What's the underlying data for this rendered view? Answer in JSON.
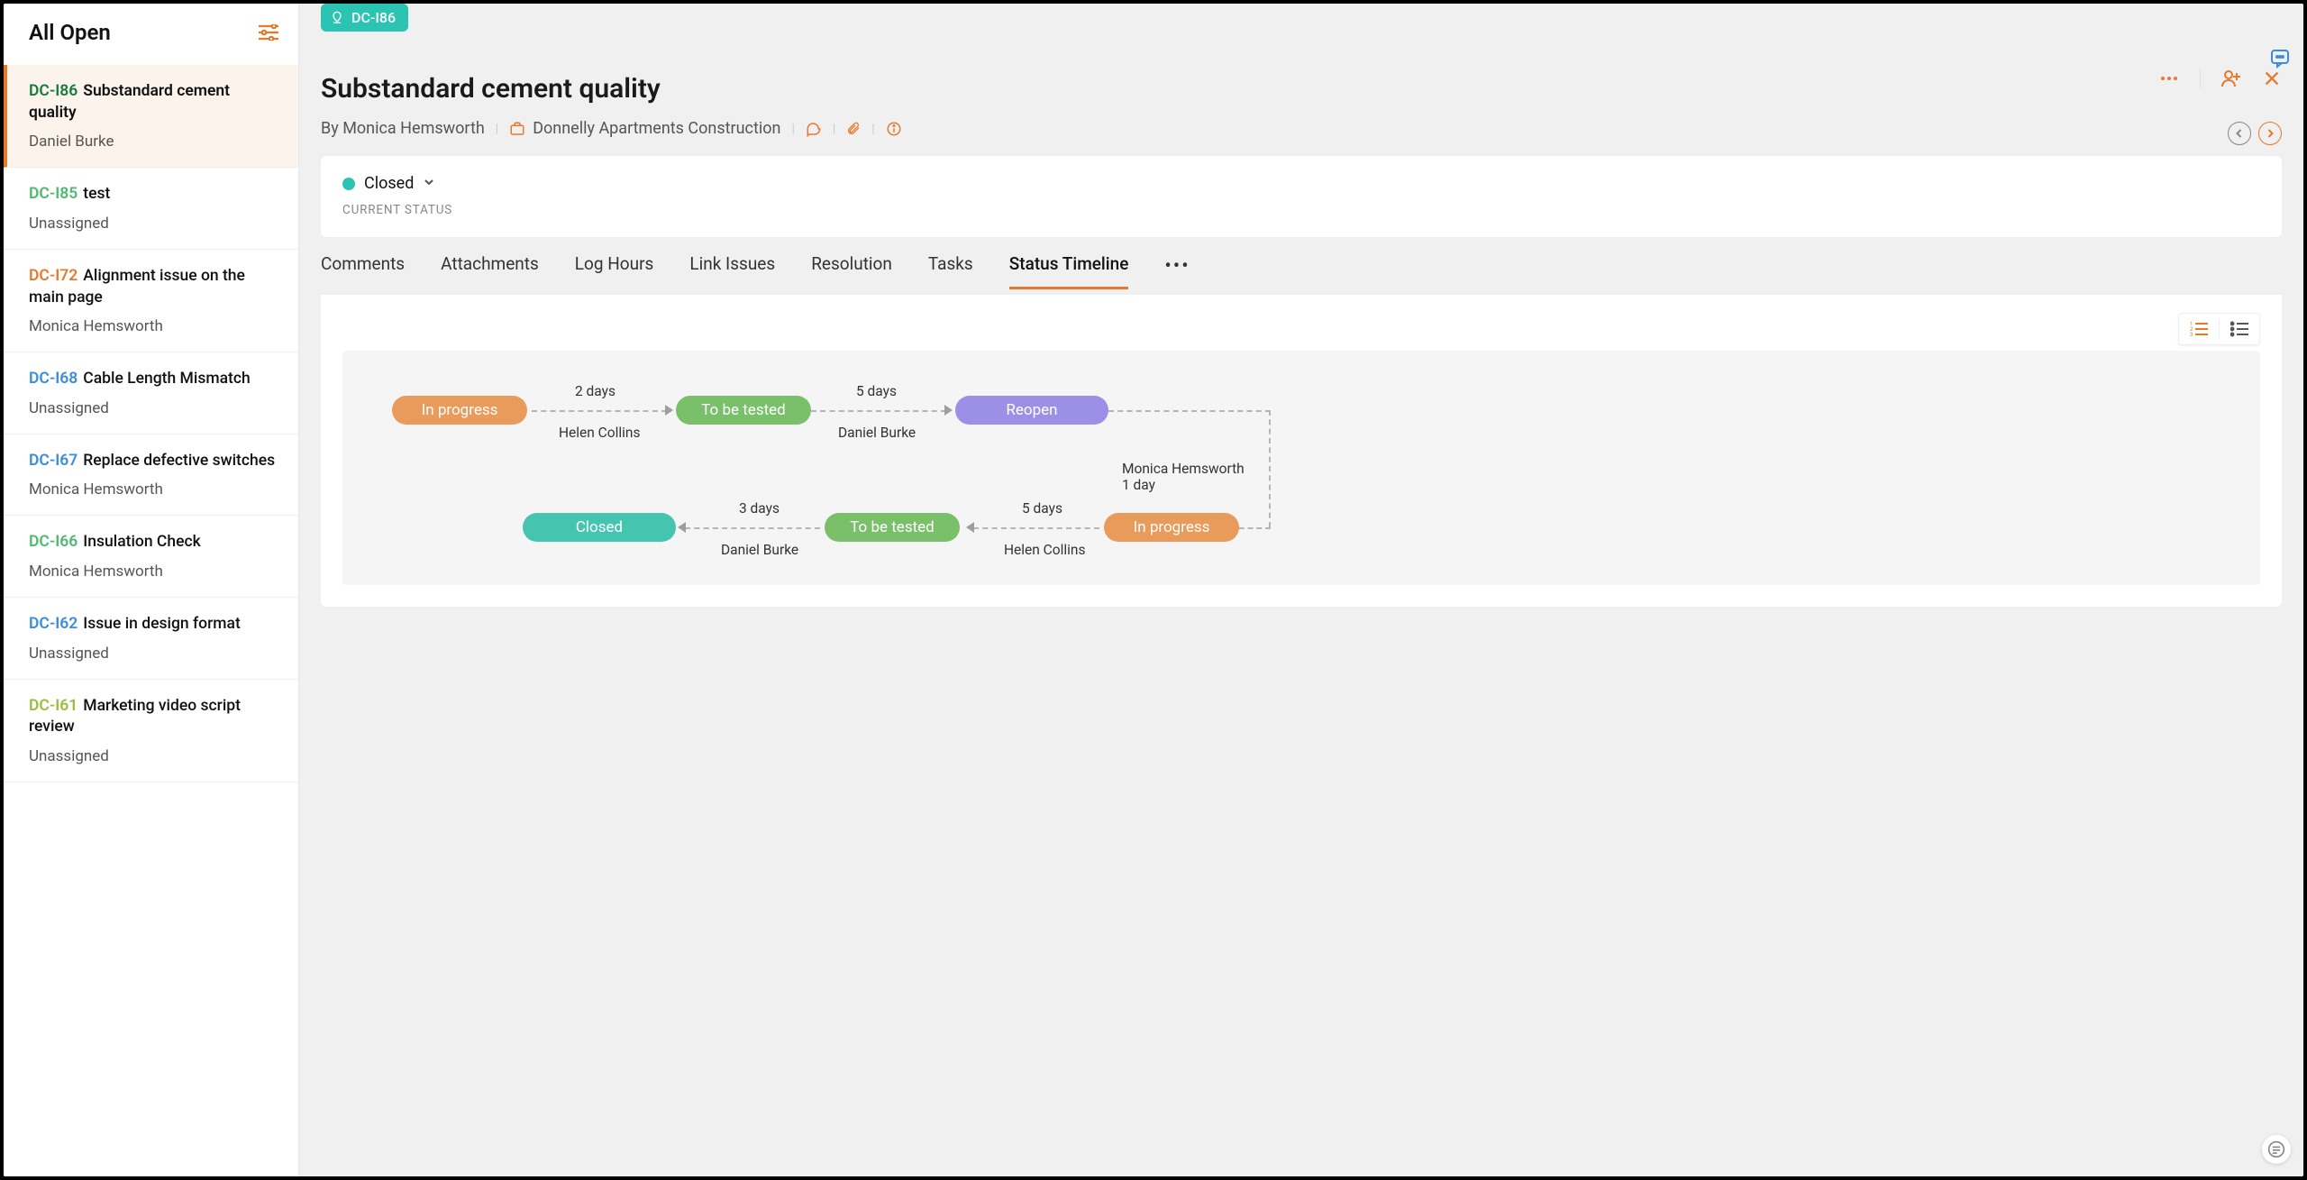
{
  "sidebar": {
    "title": "All Open",
    "items": [
      {
        "id": "DC-I86",
        "idColor": "green-dark",
        "title": "Substandard cement quality",
        "assignee": "Daniel Burke",
        "active": true
      },
      {
        "id": "DC-I85",
        "idColor": "green",
        "title": "test",
        "assignee": "Unassigned"
      },
      {
        "id": "DC-I72",
        "idColor": "orange",
        "title": "Alignment issue on the main page",
        "assignee": "Monica Hemsworth"
      },
      {
        "id": "DC-I68",
        "idColor": "blue",
        "title": "Cable Length Mismatch",
        "assignee": "Unassigned"
      },
      {
        "id": "DC-I67",
        "idColor": "blue",
        "title": "Replace defective switches",
        "assignee": "Monica Hemsworth"
      },
      {
        "id": "DC-I66",
        "idColor": "green",
        "title": "Insulation Check",
        "assignee": "Monica Hemsworth"
      },
      {
        "id": "DC-I62",
        "idColor": "blue",
        "title": "Issue in design format",
        "assignee": "Unassigned"
      },
      {
        "id": "DC-I61",
        "idColor": "lime",
        "title": "Marketing video script review",
        "assignee": "Unassigned"
      }
    ]
  },
  "issue": {
    "chip_id": "DC-I86",
    "title": "Substandard cement quality",
    "by_prefix": "By ",
    "author": "Monica Hemsworth",
    "project": "Donnelly Apartments Construction",
    "status_value": "Closed",
    "status_label": "CURRENT STATUS"
  },
  "tabs": {
    "items": [
      "Comments",
      "Attachments",
      "Log Hours",
      "Link Issues",
      "Resolution",
      "Tasks",
      "Status Timeline"
    ],
    "active_index": 6
  },
  "timeline": {
    "nodes": {
      "r0n0": "In progress",
      "r0n1": "To be tested",
      "r0n2": "Reopen",
      "r1n0": "In progress",
      "r1n1": "To be tested",
      "r1n2": "Closed"
    },
    "edges": {
      "e01_dur": "2 days",
      "e01_by": "Helen Collins",
      "e12_dur": "5 days",
      "e12_by": "Daniel Burke",
      "turn_by": "Monica Hemsworth",
      "turn_dur": "1 day",
      "e34_dur": "5 days",
      "e34_by": "Helen Collins",
      "e45_dur": "3 days",
      "e45_by": "Daniel Burke"
    }
  },
  "colors": {
    "accent": "#e7792b",
    "teal": "#2bc4b2",
    "green": "#7abf6a",
    "purple": "#9c8fe6",
    "orange": "#e89b5a"
  }
}
